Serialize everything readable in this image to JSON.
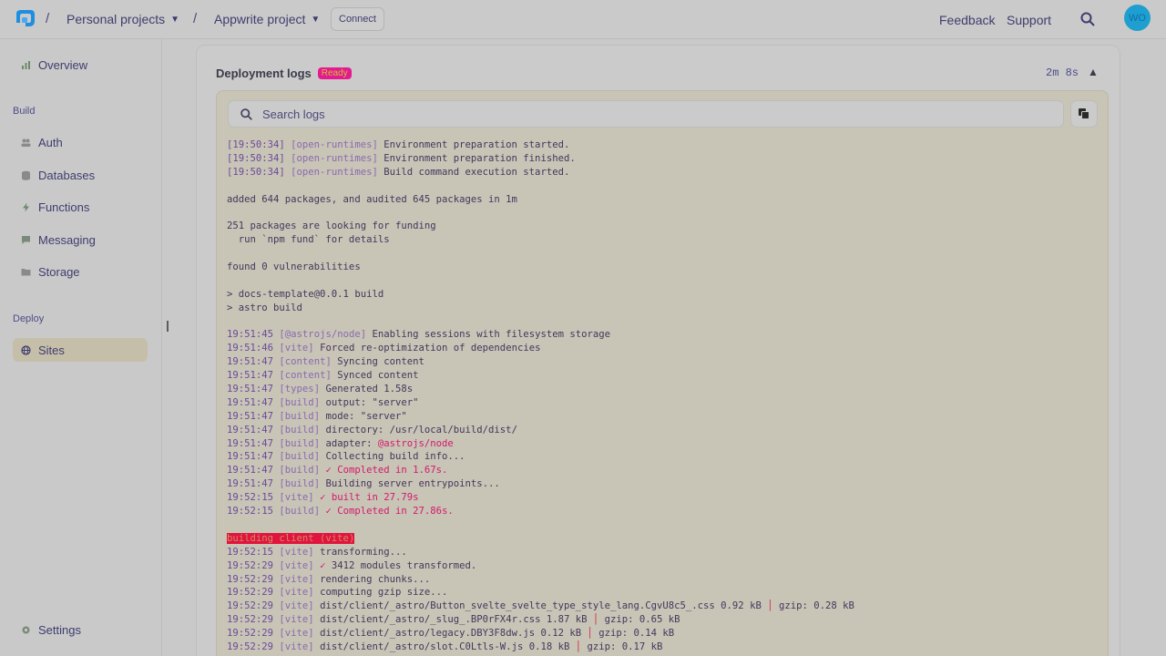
{
  "topbar": {
    "breadcrumb": [
      "Personal projects",
      "Appwrite project"
    ],
    "connect_label": "Connect",
    "feedback_label": "Feedback",
    "support_label": "Support",
    "avatar_initials": "WO"
  },
  "sidebar": {
    "overview": "Overview",
    "build_label": "Build",
    "build_items": [
      "Auth",
      "Databases",
      "Functions",
      "Messaging",
      "Storage"
    ],
    "deploy_label": "Deploy",
    "deploy_items": [
      "Sites"
    ],
    "settings": "Settings"
  },
  "main": {
    "title": "Deployment logs",
    "status_badge": "Ready",
    "duration": "2m 8s",
    "search_placeholder": "Search logs"
  },
  "logs": [
    {
      "ts": "[19:50:34]",
      "tag": "[open-runtimes]",
      "msg": "Environment preparation started."
    },
    {
      "ts": "[19:50:34]",
      "tag": "[open-runtimes]",
      "msg": "Environment preparation finished."
    },
    {
      "ts": "[19:50:34]",
      "tag": "[open-runtimes]",
      "msg": "Build command execution started."
    },
    {
      "blank": true
    },
    {
      "plain": "added 644 packages, and audited 645 packages in 1m"
    },
    {
      "blank": true
    },
    {
      "plain": "251 packages are looking for funding"
    },
    {
      "plain": "  run `npm fund` for details"
    },
    {
      "blank": true
    },
    {
      "plain": "found 0 vulnerabilities"
    },
    {
      "blank": true
    },
    {
      "plain": "> docs-template@0.0.1 build"
    },
    {
      "plain": "> astro build"
    },
    {
      "blank": true
    },
    {
      "ts": "19:51:45",
      "tag": "[@astrojs/node]",
      "msg": "Enabling sessions with filesystem storage"
    },
    {
      "ts": "19:51:46",
      "tag": "[vite]",
      "msg": "Forced re-optimization of dependencies"
    },
    {
      "ts": "19:51:47",
      "tag": "[content]",
      "msg": "Syncing content"
    },
    {
      "ts": "19:51:47",
      "tag": "[content]",
      "msg": "Synced content"
    },
    {
      "ts": "19:51:47",
      "tag": "[types]",
      "msg": "Generated 1.58s"
    },
    {
      "ts": "19:51:47",
      "tag": "[build]",
      "msg": "output: \"server\""
    },
    {
      "ts": "19:51:47",
      "tag": "[build]",
      "msg": "mode: \"server\""
    },
    {
      "ts": "19:51:47",
      "tag": "[build]",
      "msg": "directory: /usr/local/build/dist/"
    },
    {
      "ts": "19:51:47",
      "tag": "[build]",
      "msg": "adapter: ",
      "pink": "@astrojs/node"
    },
    {
      "ts": "19:51:47",
      "tag": "[build]",
      "msg": "Collecting build info..."
    },
    {
      "ts": "19:51:47",
      "tag": "[build]",
      "pink": "✓ Completed in 1.67s."
    },
    {
      "ts": "19:51:47",
      "tag": "[build]",
      "msg": "Building server entrypoints..."
    },
    {
      "ts": "19:52:15",
      "tag": "[vite]",
      "pink": "✓ built in 27.79s"
    },
    {
      "ts": "19:52:15",
      "tag": "[build]",
      "pink": "✓ Completed in 27.86s."
    },
    {
      "blank": true
    },
    {
      "highlight": "building client (vite)"
    },
    {
      "ts": "19:52:15",
      "tag": "[vite]",
      "msg": "transforming..."
    },
    {
      "ts": "19:52:29",
      "tag": "[vite]",
      "pink": "✓",
      "msg": " 3412 modules transformed."
    },
    {
      "ts": "19:52:29",
      "tag": "[vite]",
      "msg": "rendering chunks..."
    },
    {
      "ts": "19:52:29",
      "tag": "[vite]",
      "msg": "computing gzip size..."
    },
    {
      "ts": "19:52:29",
      "tag": "[vite]",
      "msg": "dist/client/_astro/Button_svelte_svelte_type_style_lang.CgvU8c5_.css 0.92 kB ",
      "bar": "│",
      "tail": " gzip: 0.28 kB"
    },
    {
      "ts": "19:52:29",
      "tag": "[vite]",
      "msg": "dist/client/_astro/_slug_.BP0rFX4r.css 1.87 kB ",
      "bar": "│",
      "tail": " gzip: 0.65 kB"
    },
    {
      "ts": "19:52:29",
      "tag": "[vite]",
      "msg": "dist/client/_astro/legacy.DBY3F8dw.js 0.12 kB ",
      "bar": "│",
      "tail": " gzip: 0.14 kB"
    },
    {
      "ts": "19:52:29",
      "tag": "[vite]",
      "msg": "dist/client/_astro/slot.C0Ltls-W.js 0.18 kB ",
      "bar": "│",
      "tail": " gzip: 0.17 kB"
    }
  ],
  "colors": {
    "accent": "#e51a8f",
    "link": "#3d3d6e",
    "avatar": "#1e9fcf"
  }
}
